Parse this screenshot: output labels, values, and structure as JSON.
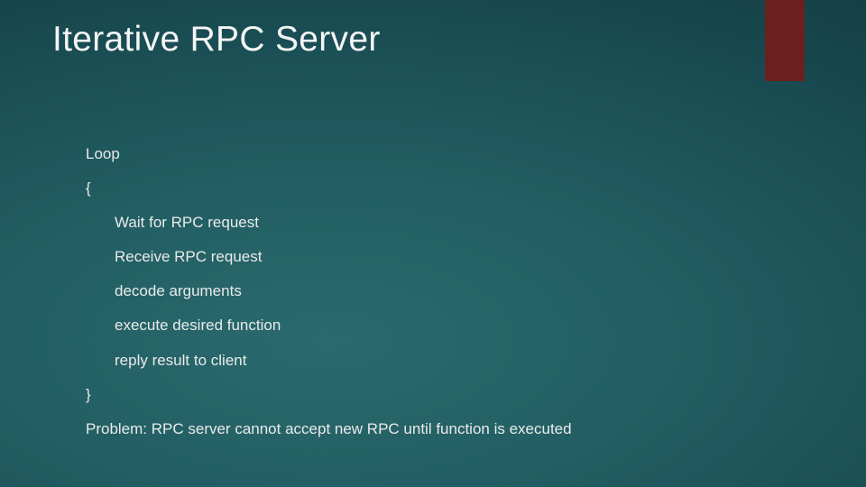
{
  "slide": {
    "title": "Iterative RPC Server",
    "lines": {
      "loop": "Loop",
      "open_brace": "{",
      "wait": "Wait for RPC request",
      "receive": "Receive RPC request",
      "decode": "decode arguments",
      "execute": "execute desired function",
      "reply": "reply result to client",
      "close_brace": "}",
      "problem": "Problem: RPC server cannot accept new RPC until function is executed"
    }
  }
}
